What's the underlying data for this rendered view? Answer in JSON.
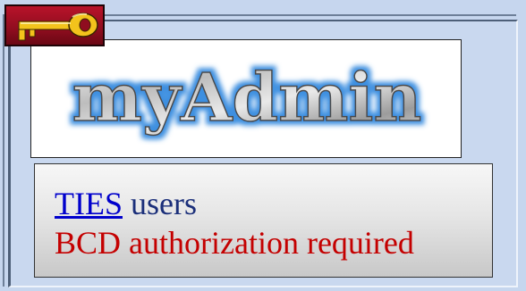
{
  "logo": {
    "text": "myAdmin",
    "icon": "key-icon"
  },
  "message": {
    "link_label": "TIES",
    "users_label": "users",
    "requirement": "BCD authorization required"
  },
  "colors": {
    "background": "#c6d6ee",
    "key_badge": "#a3112a",
    "link": "#0000cc",
    "requirement": "#c40000",
    "logo_glow": "#3d8fe0"
  }
}
